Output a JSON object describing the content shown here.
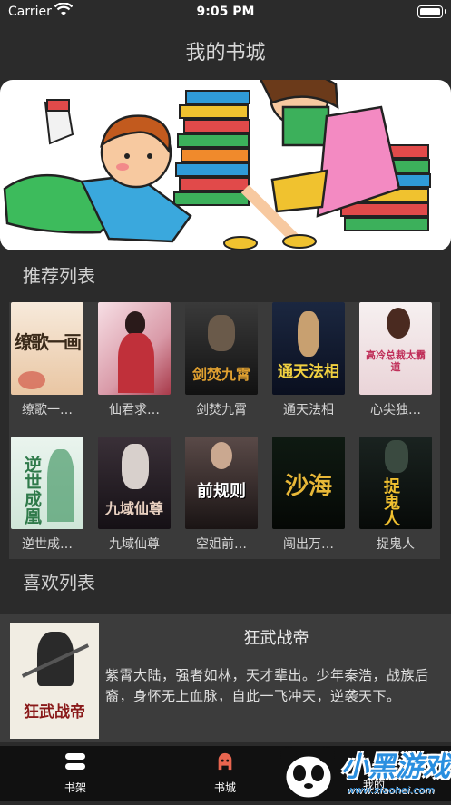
{
  "status_bar": {
    "carrier": "Carrier",
    "time": "9:05 PM"
  },
  "nav": {
    "title": "我的书城"
  },
  "sections": {
    "recommended": "推荐列表",
    "favorites": "喜欢列表"
  },
  "books": [
    {
      "name": "缭歌一…",
      "cover_text": "缭歌一画"
    },
    {
      "name": "仙君求…",
      "cover_text": ""
    },
    {
      "name": "剑焚九霄",
      "cover_text": "剑焚九霄"
    },
    {
      "name": "通天法相",
      "cover_text": "通天法相"
    },
    {
      "name": "心尖独…",
      "cover_text": "高冷总裁太霸道"
    },
    {
      "name": "逆世成…",
      "cover_text": "逆世成凰"
    },
    {
      "name": "九域仙尊",
      "cover_text": "九域仙尊"
    },
    {
      "name": "空姐前…",
      "cover_text": "前规则"
    },
    {
      "name": "闯出万…",
      "cover_text": "沙海"
    },
    {
      "name": "捉鬼人",
      "cover_text": "捉鬼人"
    }
  ],
  "favorite": {
    "title": "狂武战帝",
    "description": "紫霄大陆，强者如林，天才辈出。少年秦浩，战族后裔，身怀无上血脉，自此一飞冲天，逆袭天下。",
    "cover_text": "狂武战帝"
  },
  "tabs": {
    "shelf": "书架",
    "store": "书城",
    "third": "我的"
  },
  "watermark": {
    "text": "小黑游戏",
    "url": "www.xiaohei.com"
  },
  "colors": {
    "accent": "#e8654f",
    "background": "#2b2b2b"
  }
}
